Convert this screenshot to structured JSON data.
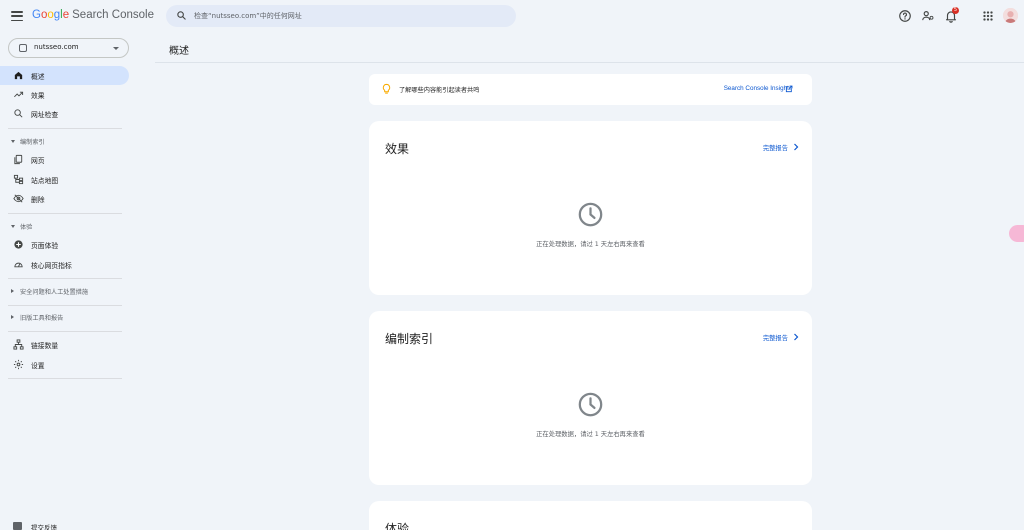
{
  "app": {
    "logo_google": [
      "G",
      "o",
      "o",
      "g",
      "l",
      "e"
    ],
    "logo_product": "Search Console"
  },
  "search": {
    "placeholder": "检查“nutsseo.com”中的任何网址"
  },
  "topbar": {
    "notification_count": "5",
    "icons": [
      "help-icon",
      "manage-users-icon",
      "notifications-icon",
      "apps-icon",
      "avatar"
    ]
  },
  "property": {
    "name": "nutsseo.com"
  },
  "sidebar": {
    "items": [
      {
        "label": "概述",
        "icon": "home-icon",
        "active": true
      },
      {
        "label": "效果",
        "icon": "trending-icon"
      },
      {
        "label": "网址检查",
        "icon": "search-icon"
      }
    ],
    "sections": [
      {
        "label": "编制索引",
        "expanded": true,
        "items": [
          {
            "label": "网页",
            "icon": "pages-icon"
          },
          {
            "label": "站点地图",
            "icon": "sitemap-icon"
          },
          {
            "label": "删除",
            "icon": "removal-icon"
          }
        ]
      },
      {
        "label": "体验",
        "expanded": true,
        "items": [
          {
            "label": "页面体验",
            "icon": "page-experience-icon"
          },
          {
            "label": "核心网页指标",
            "icon": "speed-icon"
          }
        ]
      },
      {
        "label": "安全问题和人工处置措施",
        "expanded": false
      },
      {
        "label": "旧版工具和报告",
        "expanded": false
      }
    ],
    "bottom_items": [
      {
        "label": "链接数量",
        "icon": "links-icon"
      },
      {
        "label": "设置",
        "icon": "settings-icon"
      }
    ],
    "feedback": "提交反馈"
  },
  "main": {
    "title": "概述",
    "insight_banner": {
      "text": "了解哪些内容能引起读者共鸣",
      "link": "Search Console Insights"
    },
    "cards": [
      {
        "title": "效果",
        "link": "完整报告",
        "message": "正在处理数据，请过 1 天左右再来查看"
      },
      {
        "title": "编制索引",
        "link": "完整报告",
        "message": "正在处理数据，请过 1 天左右再来查看"
      },
      {
        "title": "体验"
      }
    ]
  },
  "colors": {
    "accent": "#0b57d0",
    "active_nav": "#d3e3fd",
    "background": "#f0f4f9"
  }
}
